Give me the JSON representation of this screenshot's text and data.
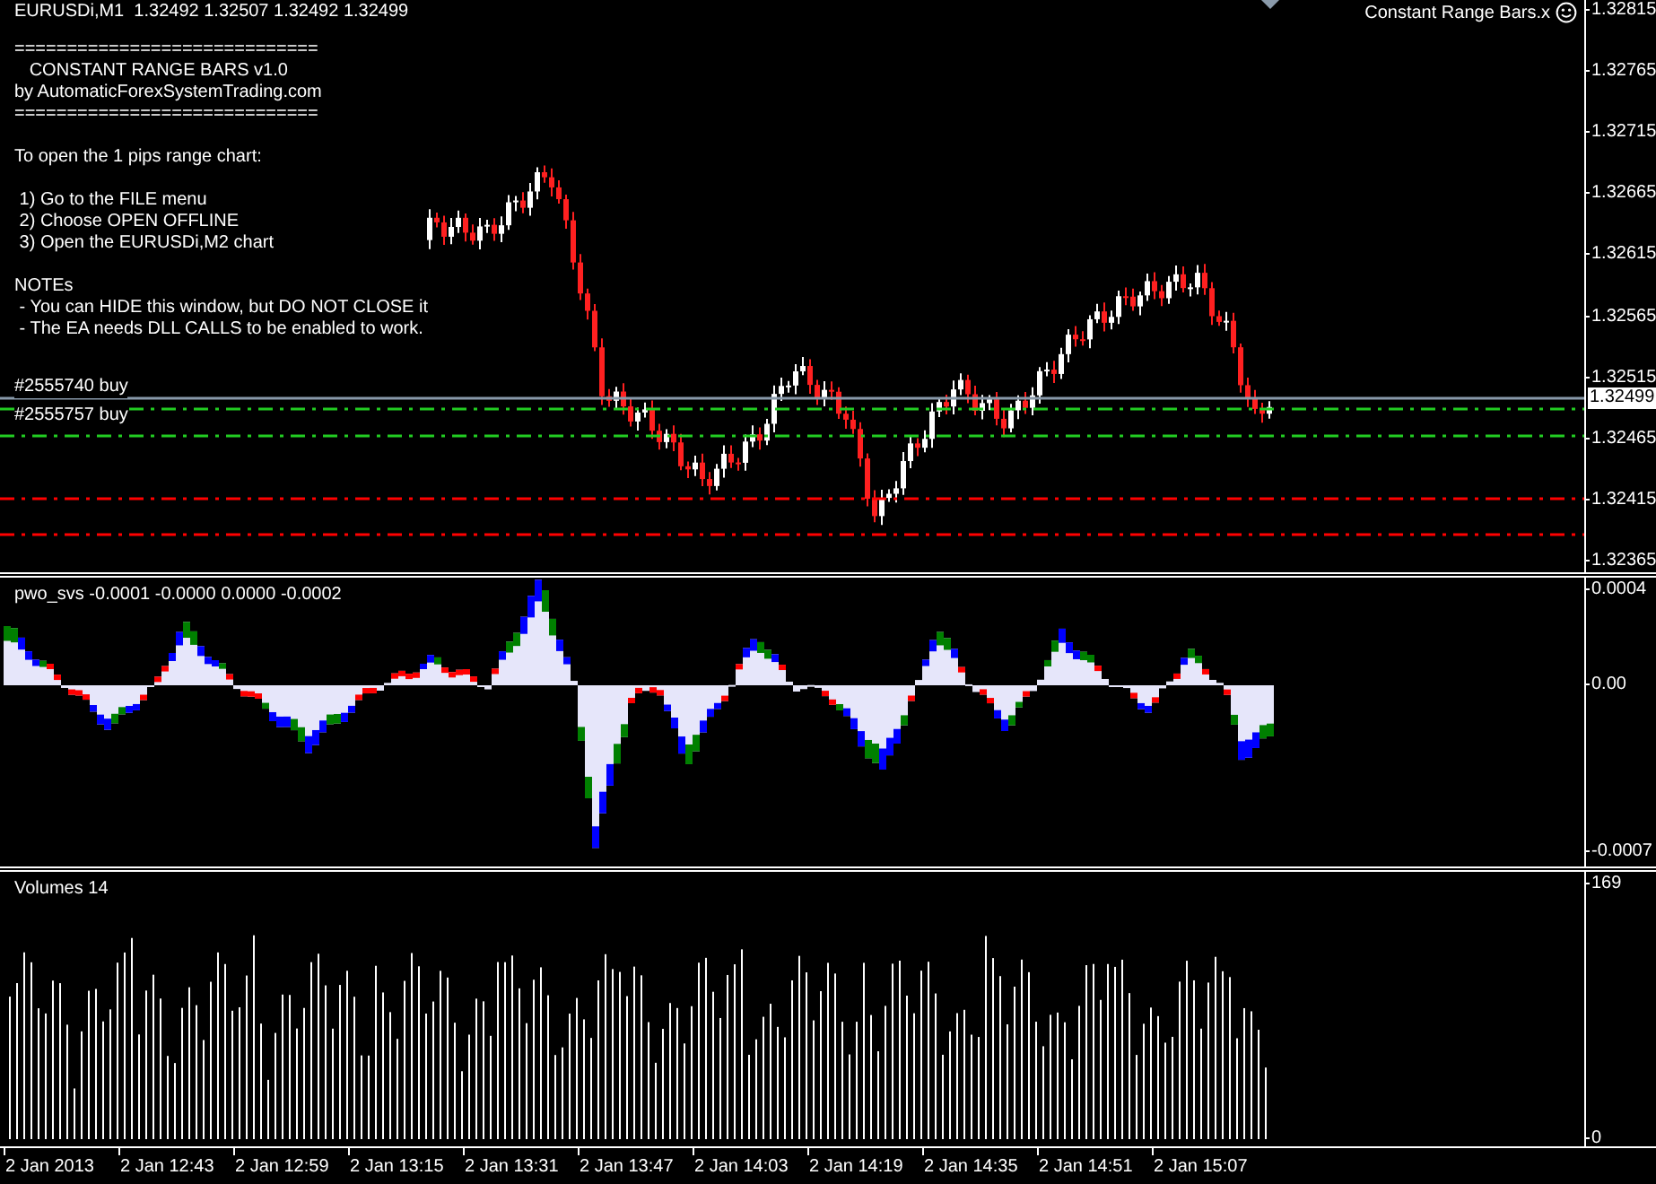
{
  "chart": {
    "title": "EURUSDi,M1  1.32492 1.32507 1.32492 1.32499",
    "expert": "Constant Range Bars.x",
    "info_blocks": [
      [
        "=============================",
        "   CONSTANT RANGE BARS v1.0",
        "by AutomaticForexSystemTrading.com",
        "============================="
      ],
      [
        "To open the 1 pips range chart:"
      ],
      [
        " 1) Go to the FILE menu",
        " 2) Choose OPEN OFFLINE",
        " 3) Open the EURUSDi,M2 chart"
      ],
      [
        "NOTEs",
        " - You can HIDE this window, but DO NOT CLOSE it",
        " - The EA needs DLL CALLS to be enabled to work."
      ]
    ],
    "orders": [
      "#2555740 buy",
      "#2555757 buy"
    ],
    "price_axis": [
      "1.32815",
      "1.32765",
      "1.32715",
      "1.32665",
      "1.32615",
      "1.32565",
      "1.32515",
      "1.32465",
      "1.32415",
      "1.32365"
    ],
    "current_price": "1.32499"
  },
  "oscillator": {
    "label": "pwo_svs -0.0001 -0.0000 0.0000 -0.0002",
    "axis": [
      "0.0004",
      "0.00",
      "-0.0007"
    ]
  },
  "volumes": {
    "label": "Volumes 14",
    "axis": [
      "169",
      "0"
    ]
  },
  "time_axis": [
    "2 Jan 2013",
    "2 Jan 12:43",
    "2 Jan 12:59",
    "2 Jan 13:15",
    "2 Jan 13:31",
    "2 Jan 13:47",
    "2 Jan 14:03",
    "2 Jan 14:19",
    "2 Jan 14:35",
    "2 Jan 14:51",
    "2 Jan 15:07"
  ]
}
